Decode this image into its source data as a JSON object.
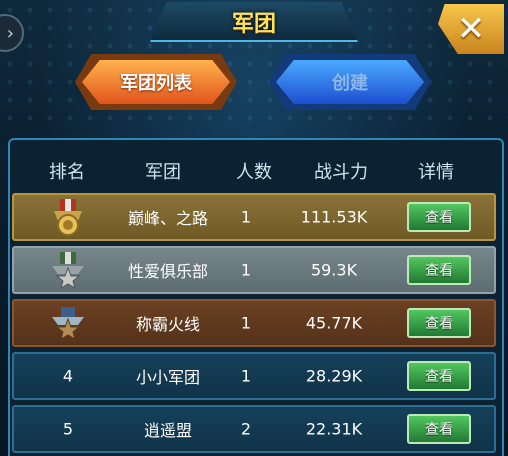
{
  "header": {
    "title": "军团"
  },
  "tabs": {
    "list_label": "军团列表",
    "create_label": "创建"
  },
  "icons": {
    "back": "chevron-right-icon",
    "close": "close-icon"
  },
  "table": {
    "columns": [
      "排名",
      "军团",
      "人数",
      "战斗力",
      "详情"
    ],
    "rows": [
      {
        "rank": "",
        "medal": "gold-medal-icon",
        "name": "巅峰、之路",
        "members": "1",
        "power": "111.53K",
        "action": "查看"
      },
      {
        "rank": "",
        "medal": "silver-medal-icon",
        "name": "性爱俱乐部",
        "members": "1",
        "power": "59.3K",
        "action": "查看"
      },
      {
        "rank": "",
        "medal": "bronze-medal-icon",
        "name": "称霸火线",
        "members": "1",
        "power": "45.77K",
        "action": "查看"
      },
      {
        "rank": "4",
        "medal": "",
        "name": "小小军团",
        "members": "1",
        "power": "28.29K",
        "action": "查看"
      },
      {
        "rank": "5",
        "medal": "",
        "name": "逍遥盟",
        "members": "2",
        "power": "22.31K",
        "action": "查看"
      }
    ]
  }
}
